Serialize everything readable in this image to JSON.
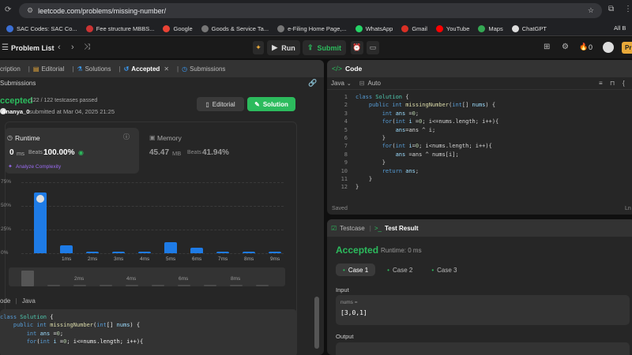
{
  "browser": {
    "url": "leetcode.com/problems/missing-number/"
  },
  "bookmarks": [
    {
      "label": "SAC Codes: SAC Co...",
      "color": "#3b6fd4"
    },
    {
      "label": "Fee structure MBBS...",
      "color": "#cc3333"
    },
    {
      "label": "Google",
      "color": "#ea4335"
    },
    {
      "label": "Goods & Service Ta...",
      "color": "#777777"
    },
    {
      "label": "e-Filing Home Page,...",
      "color": "#777777"
    },
    {
      "label": "WhatsApp",
      "color": "#25d366"
    },
    {
      "label": "Gmail",
      "color": "#d93025"
    },
    {
      "label": "YouTube",
      "color": "#ff0000"
    },
    {
      "label": "Maps",
      "color": "#34a853"
    },
    {
      "label": "ChatGPT",
      "color": "#dddddd"
    }
  ],
  "bookmarks_all": "All B",
  "nav": {
    "problem_list": "Problem List",
    "run": "Run",
    "submit": "Submit",
    "streak": "0",
    "premium": "Pr"
  },
  "left_tabs": [
    "cription",
    "Editorial",
    "Solutions",
    "Accepted",
    "Submissions"
  ],
  "submissions_label": "Submissions",
  "result": {
    "status": "ccepted",
    "testcases": "122 / 122 testcases passed",
    "user": "Ananya_0",
    "submitted": "submitted at Mar 04, 2025 21:25",
    "editorial_btn": "Editorial",
    "solution_btn": "Solution"
  },
  "runtime": {
    "title": "Runtime",
    "value": "0",
    "unit": "ms",
    "beats_label": "Beats",
    "beats": "100.00%",
    "analyze": "Analyze Complexity"
  },
  "memory": {
    "title": "Memory",
    "value": "45.47",
    "unit": "MB",
    "beats_label": "Beats",
    "beats": "41.94%"
  },
  "chart_data": {
    "type": "bar",
    "yticks": [
      "75%",
      "50%",
      "25%",
      "0%"
    ],
    "ylim": [
      0,
      75
    ],
    "categories": [
      "0ms",
      "1ms",
      "2ms",
      "3ms",
      "4ms",
      "5ms",
      "6ms",
      "7ms",
      "8ms",
      "9ms"
    ],
    "xlabels": [
      "",
      "1ms",
      "2ms",
      "3ms",
      "4ms",
      "5ms",
      "6ms",
      "7ms",
      "8ms",
      "9ms"
    ],
    "values": [
      64,
      8,
      2,
      2,
      2,
      12,
      6,
      2,
      2,
      2
    ],
    "mini_labels": [
      "",
      "",
      "2ms",
      "",
      "4ms",
      "",
      "6ms",
      "",
      "8ms",
      ""
    ],
    "mini_values": [
      40,
      6,
      6,
      6,
      6,
      6,
      6,
      6,
      6,
      6
    ]
  },
  "code_section": {
    "lang_label": "ode",
    "lang": "Java"
  },
  "code_lines": [
    [
      [
        "kw",
        "class "
      ],
      [
        "ty",
        "Solution "
      ],
      [
        "",
        "{"
      ]
    ],
    [
      [
        "",
        "    "
      ],
      [
        "kw",
        "public int "
      ],
      [
        "fn",
        "missingNumber"
      ],
      [
        "",
        "("
      ],
      [
        "kw",
        "int"
      ],
      [
        "",
        "[] "
      ],
      [
        "var",
        "nums"
      ],
      [
        "",
        ") {"
      ]
    ],
    [
      [
        "",
        "        "
      ],
      [
        "kw",
        "int "
      ],
      [
        "var",
        "ans "
      ],
      [
        "",
        "="
      ],
      [
        "num",
        "0"
      ],
      [
        "",
        ";"
      ]
    ],
    [
      [
        "",
        "        "
      ],
      [
        "kw",
        "for"
      ],
      [
        "",
        "("
      ],
      [
        "kw",
        "int "
      ],
      [
        "var",
        "i "
      ],
      [
        "",
        "="
      ],
      [
        "num",
        "0"
      ],
      [
        "",
        "; i<=nums.length; i++){"
      ]
    ]
  ],
  "editor": {
    "title": "Code",
    "lang": "Java",
    "auto": "Auto",
    "saved": "Saved",
    "ln_col": "Ln",
    "lines": [
      [
        [
          "kw",
          "class "
        ],
        [
          "ty",
          "Solution "
        ],
        [
          "",
          "{"
        ]
      ],
      [
        [
          "",
          "    "
        ],
        [
          "kw",
          "public int "
        ],
        [
          "fn",
          "missingNumber"
        ],
        [
          "",
          "("
        ],
        [
          "kw",
          "int"
        ],
        [
          "",
          "[] "
        ],
        [
          "var",
          "nums"
        ],
        [
          "",
          ") {"
        ]
      ],
      [
        [
          "",
          "        "
        ],
        [
          "kw",
          "int "
        ],
        [
          "var",
          "ans "
        ],
        [
          "",
          "="
        ],
        [
          "num",
          "0"
        ],
        [
          "",
          ";"
        ]
      ],
      [
        [
          "",
          "        "
        ],
        [
          "kw",
          "for"
        ],
        [
          "",
          "("
        ],
        [
          "kw",
          "int "
        ],
        [
          "var",
          "i "
        ],
        [
          "",
          "="
        ],
        [
          "num",
          "0"
        ],
        [
          "",
          "; i<=nums.length; i++){"
        ]
      ],
      [
        [
          "",
          "            "
        ],
        [
          "var",
          "ans"
        ],
        [
          "",
          "=ans ^ i;"
        ]
      ],
      [
        [
          "",
          "        "
        ],
        [
          "",
          "}"
        ]
      ],
      [
        [
          "",
          "        "
        ],
        [
          "kw",
          "for"
        ],
        [
          "",
          "("
        ],
        [
          "kw",
          "int "
        ],
        [
          "var",
          "i"
        ],
        [
          "",
          "="
        ],
        [
          "num",
          "0"
        ],
        [
          "",
          "; i<nums.length; i++){"
        ]
      ],
      [
        [
          "",
          "            "
        ],
        [
          "var",
          "ans "
        ],
        [
          "",
          "=ans ^ nums[i];"
        ]
      ],
      [
        [
          "",
          "        "
        ],
        [
          "",
          "}"
        ]
      ],
      [
        [
          "",
          "        "
        ],
        [
          "kw",
          "return "
        ],
        [
          "var",
          "ans"
        ],
        [
          "",
          ";"
        ]
      ],
      [
        [
          "",
          "    "
        ],
        [
          "",
          "}"
        ]
      ],
      [
        [
          "",
          "}"
        ]
      ]
    ]
  },
  "test": {
    "testcase_tab": "Testcase",
    "result_tab": "Test Result",
    "status": "Accepted",
    "runtime": "Runtime: 0 ms",
    "cases": [
      "Case 1",
      "Case 2",
      "Case 3"
    ],
    "input_label": "Input",
    "var_label": "nums =",
    "input_value": "[3,0,1]",
    "output_label": "Output"
  }
}
